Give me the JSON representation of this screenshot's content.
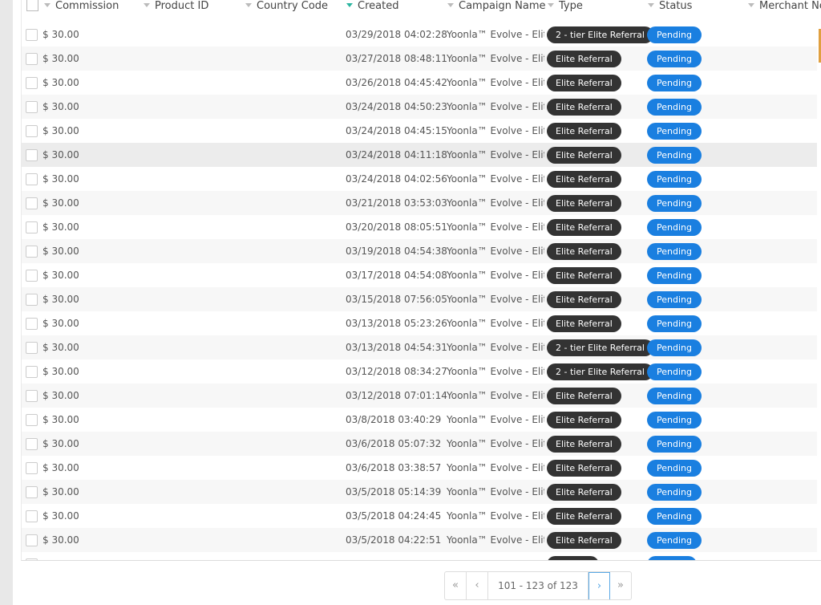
{
  "table": {
    "columns": [
      {
        "label": "Commission"
      },
      {
        "label": "Product ID"
      },
      {
        "label": "Country Code"
      },
      {
        "label": "Created"
      },
      {
        "label": "Campaign Name"
      },
      {
        "label": "Type"
      },
      {
        "label": "Status"
      },
      {
        "label": "Merchant No"
      }
    ],
    "rows": [
      {
        "commission": "$ 30.00",
        "created": "03/29/2018 04:02:28",
        "campaign": "Yoonla™ Evolve - Elite",
        "type": "2 - tier Elite Referral",
        "status": "Pending"
      },
      {
        "commission": "$ 30.00",
        "created": "03/27/2018 08:48:11",
        "campaign": "Yoonla™ Evolve - Elite",
        "type": "Elite Referral",
        "status": "Pending"
      },
      {
        "commission": "$ 30.00",
        "created": "03/26/2018 04:45:42",
        "campaign": "Yoonla™ Evolve - Elite",
        "type": "Elite Referral",
        "status": "Pending"
      },
      {
        "commission": "$ 30.00",
        "created": "03/24/2018 04:50:23",
        "campaign": "Yoonla™ Evolve - Elite",
        "type": "Elite Referral",
        "status": "Pending"
      },
      {
        "commission": "$ 30.00",
        "created": "03/24/2018 04:45:15",
        "campaign": "Yoonla™ Evolve - Elite",
        "type": "Elite Referral",
        "status": "Pending"
      },
      {
        "commission": "$ 30.00",
        "created": "03/24/2018 04:11:18",
        "campaign": "Yoonla™ Evolve - Elite",
        "type": "Elite Referral",
        "status": "Pending"
      },
      {
        "commission": "$ 30.00",
        "created": "03/24/2018 04:02:56",
        "campaign": "Yoonla™ Evolve - Elite",
        "type": "Elite Referral",
        "status": "Pending"
      },
      {
        "commission": "$ 30.00",
        "created": "03/21/2018 03:53:03",
        "campaign": "Yoonla™ Evolve - Elite",
        "type": "Elite Referral",
        "status": "Pending"
      },
      {
        "commission": "$ 30.00",
        "created": "03/20/2018 08:05:51",
        "campaign": "Yoonla™ Evolve - Elite",
        "type": "Elite Referral",
        "status": "Pending"
      },
      {
        "commission": "$ 30.00",
        "created": "03/19/2018 04:54:38",
        "campaign": "Yoonla™ Evolve - Elite",
        "type": "Elite Referral",
        "status": "Pending"
      },
      {
        "commission": "$ 30.00",
        "created": "03/17/2018 04:54:08",
        "campaign": "Yoonla™ Evolve - Elite",
        "type": "Elite Referral",
        "status": "Pending"
      },
      {
        "commission": "$ 30.00",
        "created": "03/15/2018 07:56:05",
        "campaign": "Yoonla™ Evolve - Elite",
        "type": "Elite Referral",
        "status": "Pending"
      },
      {
        "commission": "$ 30.00",
        "created": "03/13/2018 05:23:26",
        "campaign": "Yoonla™ Evolve - Elite",
        "type": "Elite Referral",
        "status": "Pending"
      },
      {
        "commission": "$ 30.00",
        "created": "03/13/2018 04:54:31",
        "campaign": "Yoonla™ Evolve - Elite",
        "type": "2 - tier Elite Referral",
        "status": "Pending"
      },
      {
        "commission": "$ 30.00",
        "created": "03/12/2018 08:34:27",
        "campaign": "Yoonla™ Evolve - Elite",
        "type": "2 - tier Elite Referral",
        "status": "Pending"
      },
      {
        "commission": "$ 30.00",
        "created": "03/12/2018 07:01:14",
        "campaign": "Yoonla™ Evolve - Elite",
        "type": "Elite Referral",
        "status": "Pending"
      },
      {
        "commission": "$ 30.00",
        "created": "03/8/2018 03:40:29",
        "campaign": "Yoonla™ Evolve - Elite",
        "type": "Elite Referral",
        "status": "Pending"
      },
      {
        "commission": "$ 30.00",
        "created": "03/6/2018 05:07:32",
        "campaign": "Yoonla™ Evolve - Elite",
        "type": "Elite Referral",
        "status": "Pending"
      },
      {
        "commission": "$ 30.00",
        "created": "03/6/2018 03:38:57",
        "campaign": "Yoonla™ Evolve - Elite",
        "type": "Elite Referral",
        "status": "Pending"
      },
      {
        "commission": "$ 30.00",
        "created": "03/5/2018 05:14:39",
        "campaign": "Yoonla™ Evolve - Elite",
        "type": "Elite Referral",
        "status": "Pending"
      },
      {
        "commission": "$ 30.00",
        "created": "03/5/2018 04:24:45",
        "campaign": "Yoonla™ Evolve - Elite",
        "type": "Elite Referral",
        "status": "Pending"
      },
      {
        "commission": "$ 30.00",
        "created": "03/5/2018 04:22:51",
        "campaign": "Yoonla™ Evolve - Elite",
        "type": "Elite Referral",
        "status": "Pending"
      }
    ]
  },
  "pagination": {
    "first": "«",
    "prev": "‹",
    "info": "101 - 123 of 123",
    "next": "›",
    "last": "»"
  },
  "colors": {
    "type_pill": "#333333",
    "status_pill": "#1a7fe0",
    "sort_active": "#2bb5a0"
  }
}
